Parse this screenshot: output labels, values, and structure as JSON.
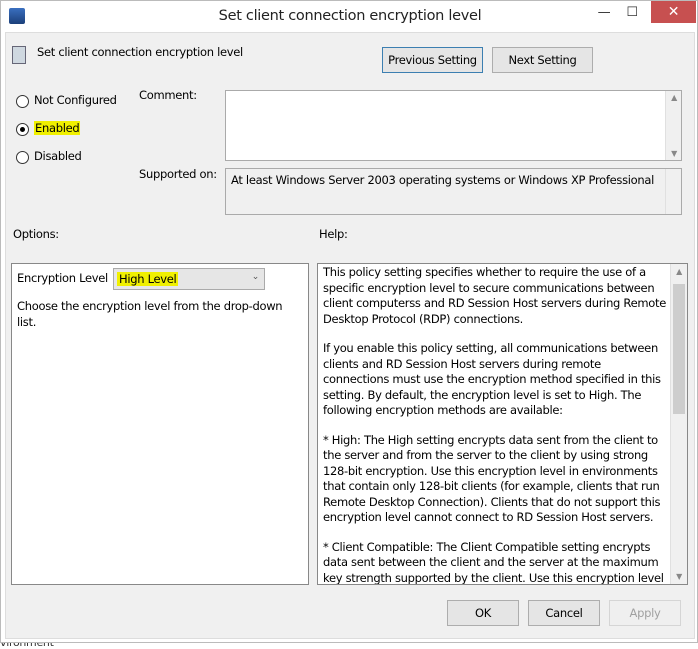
{
  "window": {
    "title": "Set client connection encryption level",
    "minimize": "—",
    "maximize": "☐",
    "close": "✕"
  },
  "header": {
    "setting_name": "Set client connection encryption level",
    "previous_setting": "Previous Setting",
    "next_setting": "Next Setting"
  },
  "state": {
    "options": [
      {
        "label": "Not Configured",
        "selected": false
      },
      {
        "label": "Enabled",
        "selected": true
      },
      {
        "label": "Disabled",
        "selected": false
      }
    ]
  },
  "comment": {
    "label": "Comment:",
    "value": ""
  },
  "supported": {
    "label": "Supported on:",
    "value": "At least Windows Server 2003 operating systems or Windows XP Professional"
  },
  "options_section": {
    "label": "Options:",
    "encryption_label": "Encryption Level",
    "encryption_value": "High Level",
    "description": "Choose the encryption level from the drop-down list."
  },
  "help_section": {
    "label": "Help:",
    "paragraphs": [
      "This policy setting specifies whether to require the use of a specific encryption level to secure communications between client computerss and RD Session Host servers during Remote Desktop Protocol (RDP) connections.",
      "If you enable this policy setting, all communications between clients and RD Session Host servers during remote connections must use the encryption method specified in this setting. By default, the encryption level is set to High. The following encryption methods are available:",
      "* High: The High setting encrypts data sent from the client to the server and from the server to the client by using strong 128-bit encryption. Use this encryption level in environments that contain only 128-bit clients (for example, clients that run Remote Desktop Connection). Clients that do not support this encryption level cannot connect to RD Session Host servers.",
      "* Client Compatible: The Client Compatible setting encrypts data sent between the client and the server at the maximum key strength supported by the client. Use this encryption level in"
    ]
  },
  "footer": {
    "ok": "OK",
    "cancel": "Cancel",
    "apply": "Apply"
  },
  "background_text": "vironment"
}
